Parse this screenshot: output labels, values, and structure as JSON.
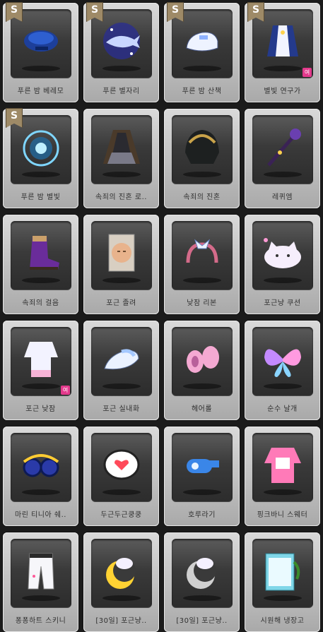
{
  "items": [
    {
      "label": "푸른 밤 베레모",
      "icon": "beret-icon",
      "s_tag": "S"
    },
    {
      "label": "푸른 별자리",
      "icon": "constellation-whale-icon",
      "s_tag": "S"
    },
    {
      "label": "푸른 밤 산책",
      "icon": "white-shoes-icon",
      "s_tag": "S"
    },
    {
      "label": "별빛 연구가",
      "icon": "starlight-outfit-icon",
      "s_tag": "S",
      "badge": "여"
    },
    {
      "label": "푸른 밤 별빛",
      "icon": "magic-circle-icon",
      "s_tag": "S"
    },
    {
      "label": "속죄의 진혼 로..",
      "icon": "dark-robe-icon"
    },
    {
      "label": "속죄의 진혼",
      "icon": "dark-helm-icon"
    },
    {
      "label": "레퀴엠",
      "icon": "dark-staff-icon"
    },
    {
      "label": "속죄의 걸음",
      "icon": "purple-boots-icon"
    },
    {
      "label": "포근 졸려",
      "icon": "sleepy-face-icon"
    },
    {
      "label": "낮잠 리본",
      "icon": "ribbon-headband-icon"
    },
    {
      "label": "포근냥 쿠션",
      "icon": "cat-cushion-icon"
    },
    {
      "label": "포근 낮잠",
      "icon": "pajama-icon",
      "badge": "여"
    },
    {
      "label": "포근 실내화",
      "icon": "slippers-icon"
    },
    {
      "label": "헤어롤",
      "icon": "hair-roller-icon"
    },
    {
      "label": "순수 날개",
      "icon": "fairy-wings-icon"
    },
    {
      "label": "마린 티니아 쉐..",
      "icon": "blue-goggles-icon"
    },
    {
      "label": "두근두근쿵쿵",
      "icon": "heart-bubble-icon"
    },
    {
      "label": "호루라기",
      "icon": "whistle-icon"
    },
    {
      "label": "핑크바니 스웨터",
      "icon": "pink-sweater-icon"
    },
    {
      "label": "퐁퐁하트 스키니",
      "icon": "heart-pants-icon"
    },
    {
      "label": "[30일] 포근냥..",
      "icon": "cat-moon-gold-icon"
    },
    {
      "label": "[30일] 포근냥..",
      "icon": "cat-moon-silver-icon"
    },
    {
      "label": "시원해 냉장고",
      "icon": "fridge-icon"
    }
  ],
  "colors": {
    "s_tag": "#9e8a67",
    "badge": "#e3398c",
    "card": "#c8c8c8",
    "well": "#3a3a3a"
  }
}
